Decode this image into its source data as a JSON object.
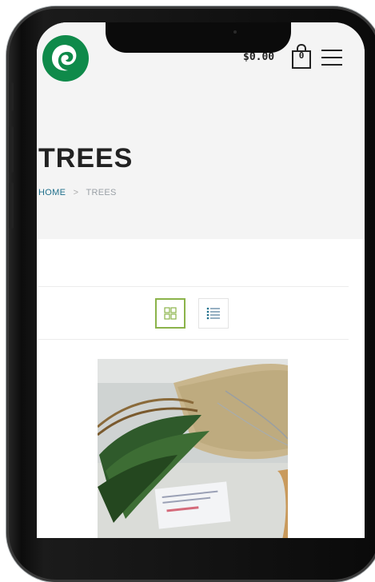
{
  "header": {
    "logo_icon": "leaf-swirl-logo",
    "cart_total": "$0.00",
    "cart_count": "0",
    "cart_icon": "shopping-bag-icon",
    "menu_icon": "hamburger-menu-icon"
  },
  "page": {
    "title": "TREES",
    "breadcrumb": {
      "home": "HOME",
      "separator": ">",
      "current": "TREES"
    }
  },
  "view_toggle": {
    "grid_icon": "grid-view-icon",
    "list_icon": "list-view-icon",
    "active": "grid"
  },
  "product": {
    "image_icon": "tree-seedlings-bundle-photo"
  },
  "colors": {
    "accent_green": "#8bb34a",
    "logo_green": "#0f8a4a",
    "link_blue": "#1f6f8b",
    "band_gray": "#f4f4f4"
  }
}
